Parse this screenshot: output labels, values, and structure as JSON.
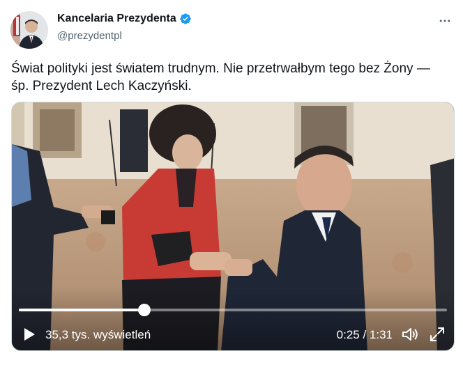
{
  "author": {
    "display_name": "Kancelaria Prezydenta",
    "handle": "@prezydentpl",
    "verified": true,
    "verified_color": "#1d9bf0"
  },
  "tweet": {
    "text_line1": "Świat polityki jest światem trudnym. Nie przetrwałbym tego bez Żony —",
    "text_line2": "śp. Prezydent Lech Kaczyński."
  },
  "video": {
    "views_text": "35,3 tys. wyświetleń",
    "time_text": "0:25 / 1:31",
    "progress_fraction": 0.293
  },
  "icons": {
    "more": "more-horizontal-icon",
    "verified": "verified-badge-icon",
    "play": "play-icon",
    "volume": "volume-icon",
    "fullscreen": "fullscreen-icon"
  }
}
